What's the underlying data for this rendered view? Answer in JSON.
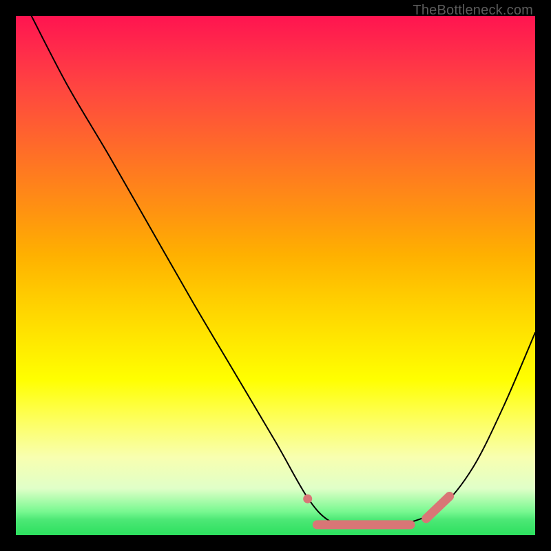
{
  "watermark": "TheBottleneck.com",
  "chart_data": {
    "type": "line",
    "title": "",
    "xlabel": "",
    "ylabel": "",
    "xlim": [
      0,
      100
    ],
    "ylim": [
      0,
      100
    ],
    "grid": false,
    "series": [
      {
        "name": "bottleneck-curve",
        "color": "#000000",
        "x": [
          3,
          10,
          18,
          26,
          34,
          42,
          50,
          56,
          60,
          64,
          70,
          76,
          82,
          88,
          94,
          100
        ],
        "values": [
          100,
          86.5,
          73,
          59,
          45,
          31.5,
          18,
          7.5,
          3,
          2,
          2,
          2.5,
          5.5,
          13,
          25,
          39
        ]
      }
    ],
    "highlight": {
      "color": "#d97676",
      "segments": [
        {
          "type": "dot",
          "x": 56.2,
          "y": 7
        },
        {
          "type": "flat",
          "x0": 58,
          "x1": 76,
          "y": 2
        },
        {
          "type": "rise",
          "x0": 79,
          "y0": 3.2,
          "x1": 83.5,
          "y1": 7.5
        }
      ]
    },
    "background_gradient": {
      "top": "#ff1450",
      "bottom": "#2ce05e"
    }
  }
}
